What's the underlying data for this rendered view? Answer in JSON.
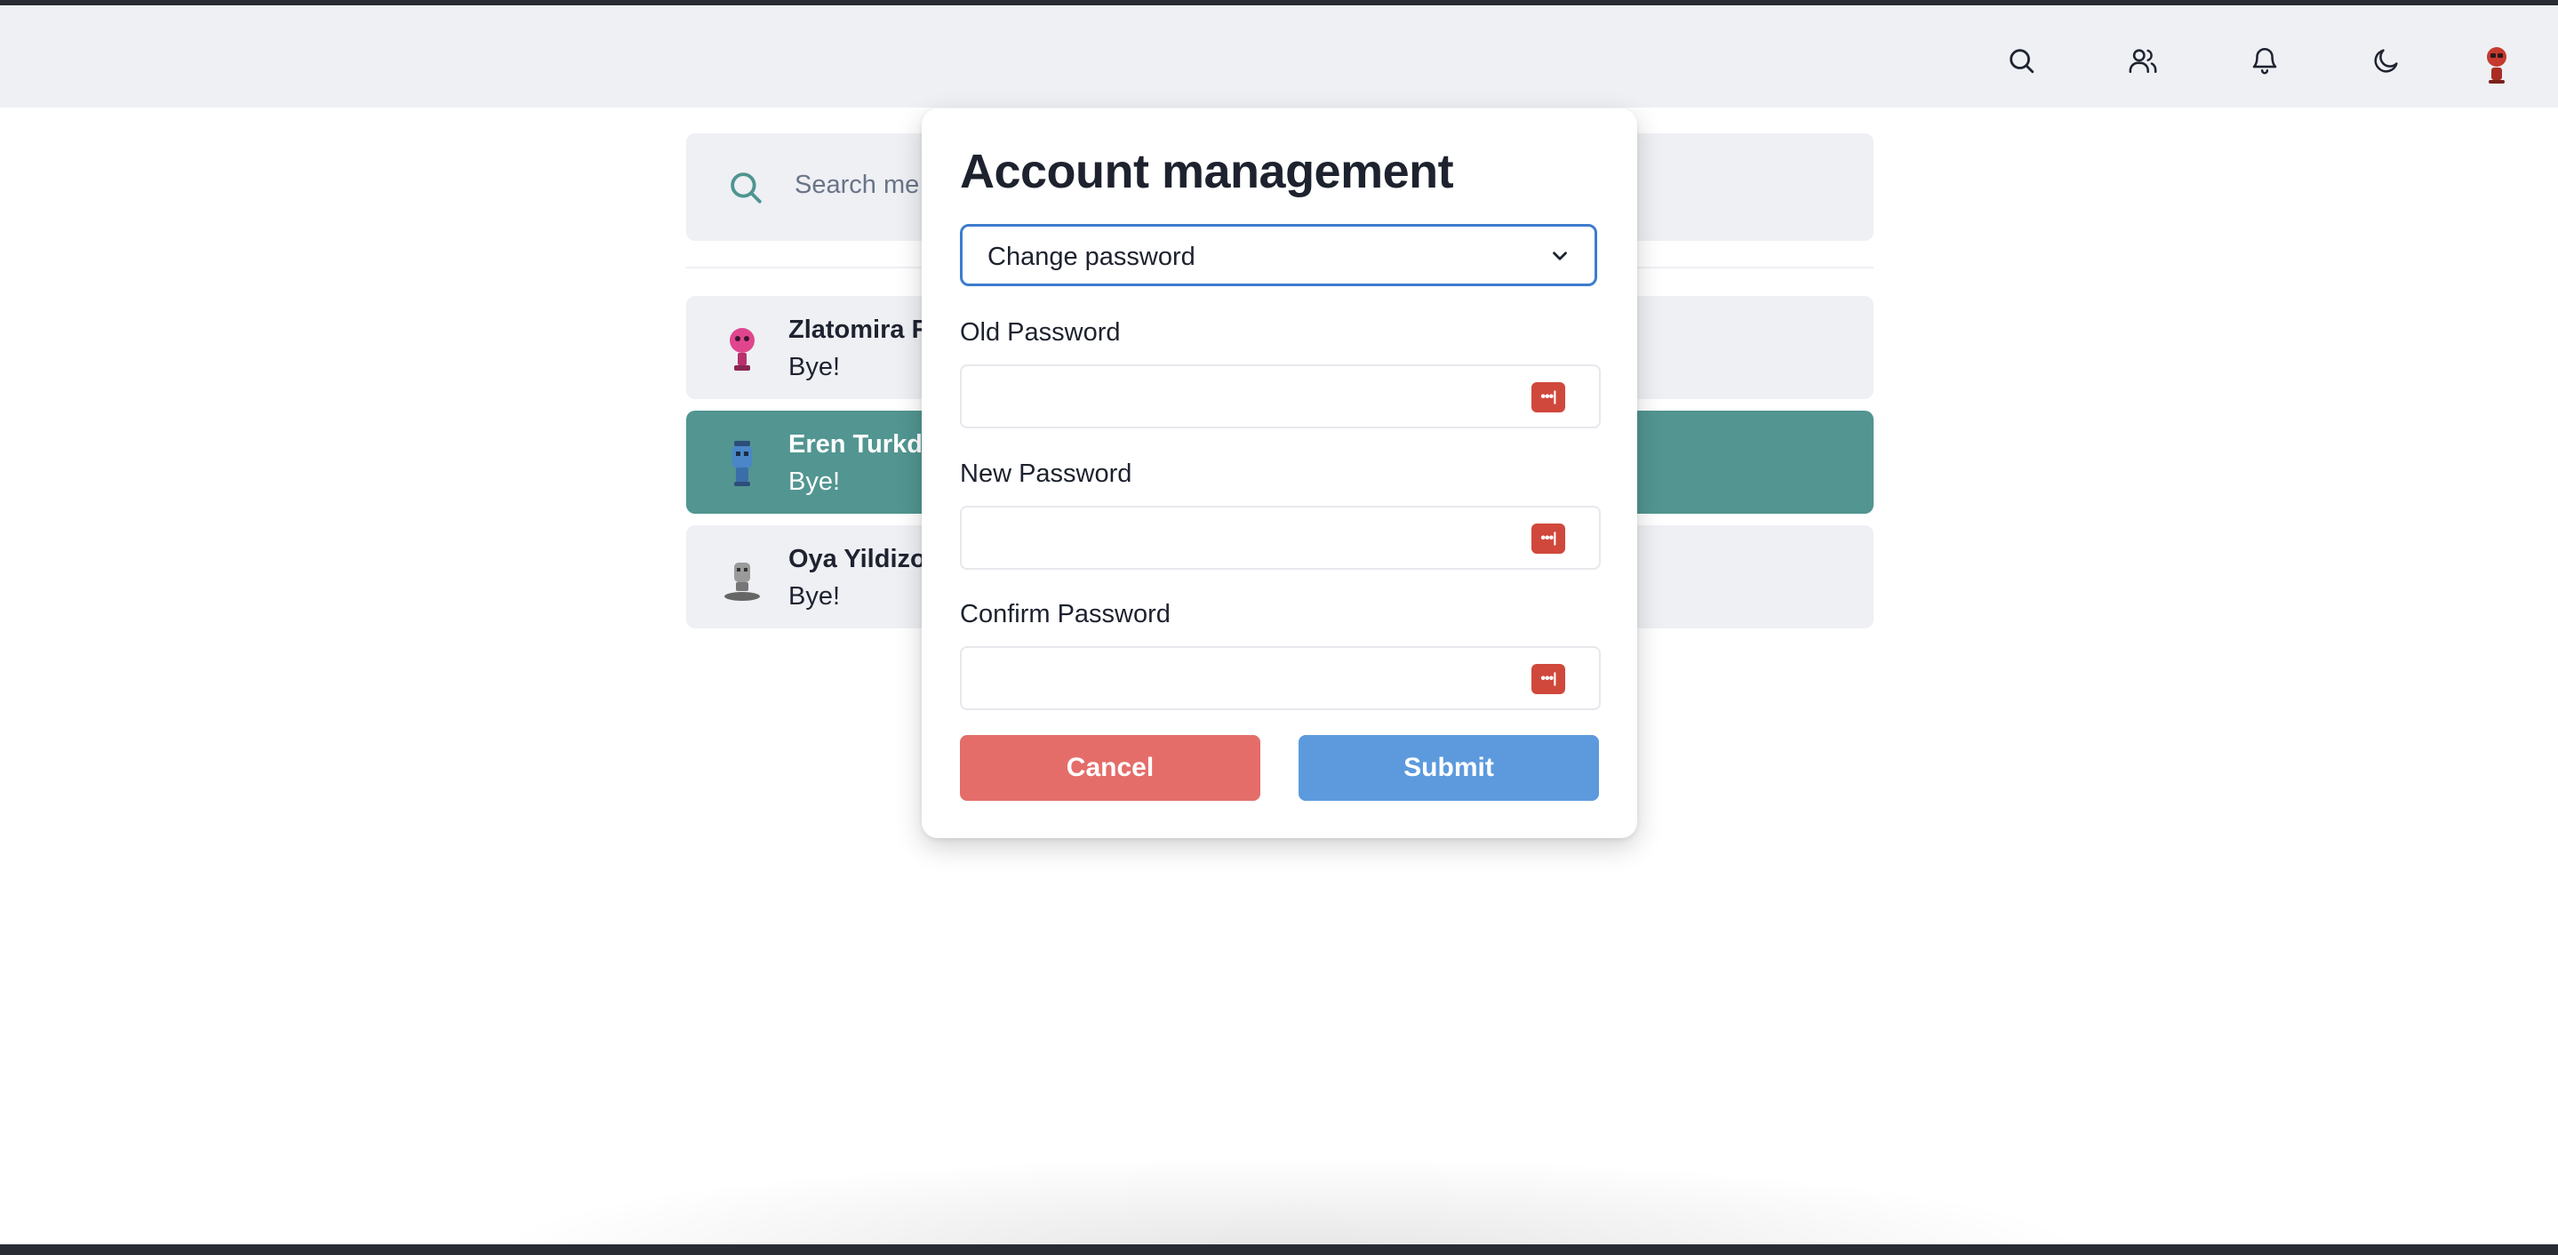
{
  "navbar": {
    "icons": [
      "search-icon",
      "users-icon",
      "bell-icon",
      "moon-icon",
      "avatar"
    ]
  },
  "search": {
    "placeholder": "Search me"
  },
  "chats": [
    {
      "name": "Zlatomira R",
      "message": "Bye!",
      "active": false
    },
    {
      "name": "Eren Turkd",
      "message": "Bye!",
      "active": true
    },
    {
      "name": "Oya Yildizo",
      "message": "Bye!",
      "active": false
    }
  ],
  "modal": {
    "title": "Account management",
    "select_value": "Change password",
    "fields": [
      {
        "label": "Old Password",
        "value": ""
      },
      {
        "label": "New Password",
        "value": ""
      },
      {
        "label": "Confirm Password",
        "value": ""
      }
    ],
    "cancel_label": "Cancel",
    "submit_label": "Submit"
  },
  "colors": {
    "accent_teal": "#529591",
    "cancel_red": "#e46d6a",
    "submit_blue": "#5c9add",
    "select_border": "#3d7ccf",
    "panel_gray": "#eef0f4"
  }
}
